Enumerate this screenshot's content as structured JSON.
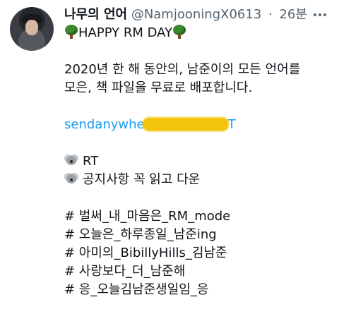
{
  "author": {
    "display_name": "나무의 언어",
    "handle": "@NamjooningX0613",
    "separator": "·",
    "time": "26분"
  },
  "tweet": {
    "title_line": "HAPPY RM DAY",
    "para1_line1": "2020년 한 해 동안의, 남준이의 모든 언어를",
    "para1_line2": "모은, 책 파일을 무료로 배포합니다.",
    "link_visible": "sendanywhe",
    "link_tail": "T",
    "bullet1": "RT",
    "bullet2": "공지사항 꼭 읽고 다운",
    "hashtags": [
      "# 벌써_내_마음은_RM_mode",
      "# 오늘은_하루종일_남준ing",
      "# 아미의_BibillyHills_김남준",
      "# 사랑보다_더_남준해",
      "# 응_오늘김남준생일임_응"
    ]
  },
  "icons": {
    "tree": "deciduous-tree-emoji",
    "koala": "koala-emoji",
    "more": "more-horizontal-icon"
  },
  "colors": {
    "text": "#0f1419",
    "muted": "#536471",
    "link": "#1d9bf0",
    "redaction": "#f2c200"
  }
}
